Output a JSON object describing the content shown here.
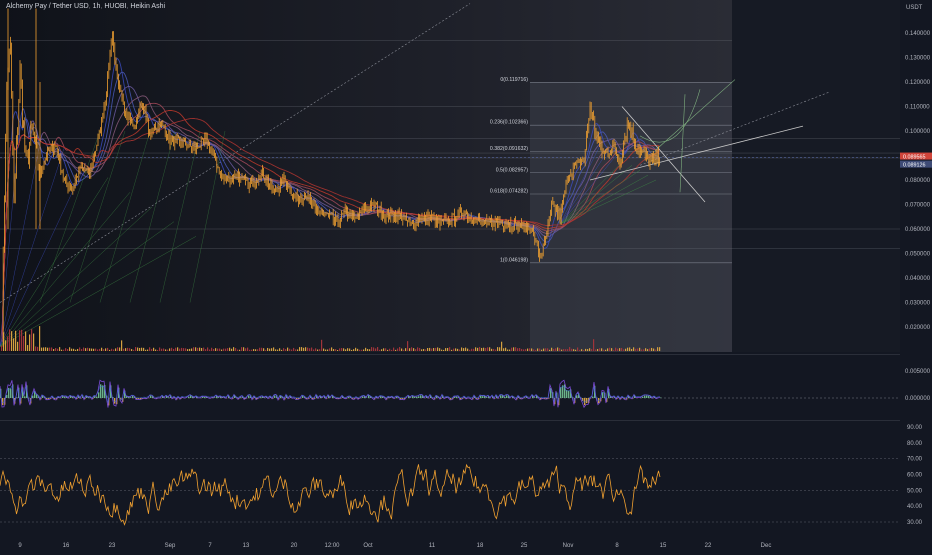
{
  "header": {
    "symbol_title": "Alchemy Pay / Tether USD",
    "interval": "1h",
    "exchange": "HUOBI",
    "chart_style": "Heikin Ashi",
    "currency": "USDT"
  },
  "colors": {
    "background": "#131722",
    "panel_bg": "#1b1e28",
    "fib_box": "#3b3e48",
    "grid": "#2a2e39",
    "candle": "#f0a030",
    "ribbon_red": "#c0392b",
    "ribbon_blue": "#3b4bbf",
    "ribbon_green": "#3d8a45",
    "last_price_tag": "#d0443a",
    "marker_price_tag": "#3e4b76"
  },
  "price_axis": {
    "ticks": [
      "0.140000",
      "0.130000",
      "0.120000",
      "0.110000",
      "0.100000",
      "0.090000",
      "0.080000",
      "0.070000",
      "0.060000",
      "0.050000",
      "0.040000",
      "0.030000",
      "0.020000"
    ],
    "last_price_tag": "0.089565",
    "marker_tag": "0.089126"
  },
  "fib_levels": [
    {
      "level": "0",
      "label": "0(0.119716)",
      "price": 0.119716
    },
    {
      "level": "0.236",
      "label": "0.236(0.102366)",
      "price": 0.102366
    },
    {
      "level": "0.382",
      "label": "0.382(0.091632)",
      "price": 0.091632
    },
    {
      "level": "0.5",
      "label": "0.5(0.082957)",
      "price": 0.082957
    },
    {
      "level": "0.618",
      "label": "0.618(0.074282)",
      "price": 0.074282
    },
    {
      "level": "1",
      "label": "1(0.046198)",
      "price": 0.046198
    }
  ],
  "osc_axis": {
    "ticks": [
      "0.005000",
      "0.000000"
    ]
  },
  "rsi_axis": {
    "ticks": [
      "90.00",
      "80.00",
      "70.00",
      "60.00",
      "50.00",
      "40.00",
      "30.00"
    ]
  },
  "time_axis": {
    "labels": [
      "9",
      "16",
      "23",
      "Sep",
      "7",
      "13",
      "20",
      "12:00",
      "Oct",
      "11",
      "18",
      "25",
      "Nov",
      "8",
      "15",
      "22",
      "Dec"
    ]
  },
  "chart_data": [
    {
      "type": "line",
      "name": "price",
      "title": "Alchemy Pay / Tether USD, 1h, HUOBI, Heikin Ashi",
      "x": [
        "9",
        "16",
        "23",
        "Sep",
        "7",
        "13",
        "20",
        "12:00",
        "Oct",
        "11",
        "18",
        "25",
        "Nov",
        "8",
        "15"
      ],
      "values": [
        0.1,
        0.08,
        0.105,
        0.085,
        0.09,
        0.072,
        0.07,
        0.063,
        0.06,
        0.063,
        0.062,
        0.06,
        0.055,
        0.092,
        0.0896
      ],
      "ylim": [
        0.01,
        0.15
      ],
      "last_value": 0.089565,
      "grid": true
    },
    {
      "type": "line",
      "name": "oscillator",
      "ylim": [
        -0.002,
        0.007
      ],
      "ticks": [
        0.005,
        0.0
      ]
    },
    {
      "type": "line",
      "name": "rsi",
      "ylim": [
        25,
        95
      ],
      "ticks": [
        90,
        80,
        70,
        60,
        50,
        40,
        30
      ]
    }
  ]
}
